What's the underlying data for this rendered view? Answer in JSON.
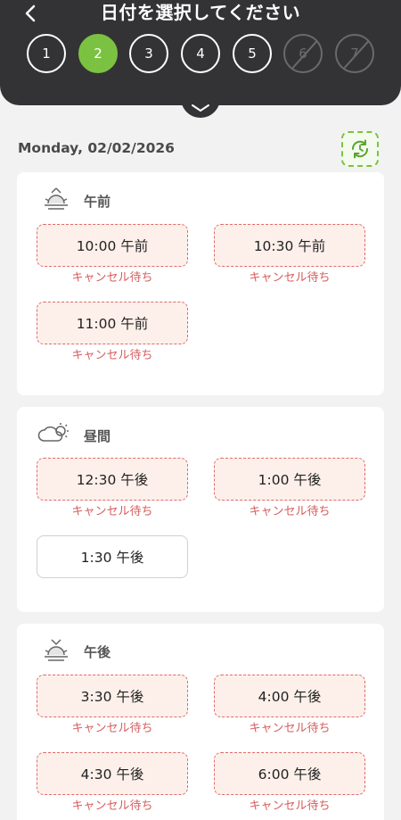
{
  "header": {
    "title": "日付を選択してください",
    "days": [
      {
        "label": "1",
        "state": "normal"
      },
      {
        "label": "2",
        "state": "selected"
      },
      {
        "label": "3",
        "state": "normal"
      },
      {
        "label": "4",
        "state": "normal"
      },
      {
        "label": "5",
        "state": "normal"
      },
      {
        "label": "6",
        "state": "disabled"
      },
      {
        "label": "7",
        "state": "disabled"
      }
    ]
  },
  "date_label": "Monday,  02/02/2026",
  "sections": {
    "morning": {
      "title": "午前",
      "slots": [
        {
          "time": "10:00 午前",
          "status": "キャンセル待ち"
        },
        {
          "time": "10:30 午前",
          "status": "キャンセル待ち"
        },
        {
          "time": "11:00 午前",
          "status": "キャンセル待ち"
        }
      ]
    },
    "afternoon": {
      "title": "昼間",
      "slots": [
        {
          "time": "12:30 午後",
          "status": "キャンセル待ち"
        },
        {
          "time": "1:00 午後",
          "status": "キャンセル待ち"
        },
        {
          "time": "1:30 午後",
          "status": ""
        }
      ]
    },
    "evening": {
      "title": "午後",
      "slots": [
        {
          "time": "3:30 午後",
          "status": "キャンセル待ち"
        },
        {
          "time": "4:00 午後",
          "status": "キャンセル待ち"
        },
        {
          "time": "4:30 午後",
          "status": "キャンセル待ち"
        },
        {
          "time": "6:00 午後",
          "status": "キャンセル待ち"
        }
      ]
    }
  },
  "colors": {
    "header_bg": "#333335",
    "accent_green": "#7cc242",
    "waitlist_red": "#d65c5c",
    "waitlist_bg": "#fdf0ea"
  },
  "icons": [
    "back-chevron-icon",
    "refresh-clock-icon",
    "sunrise-icon",
    "cloud-sun-icon",
    "sunset-icon",
    "chevron-down-icon"
  ]
}
